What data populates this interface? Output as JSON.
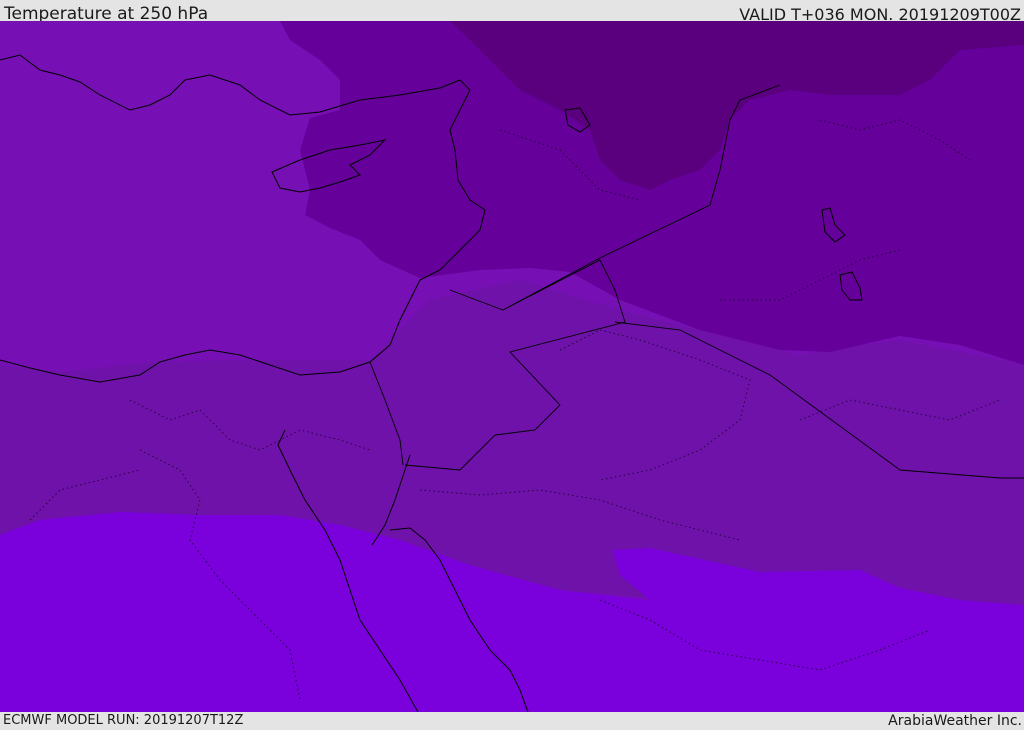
{
  "header": {
    "title": "Temperature at 250 hPa",
    "valid_time": "VALID T+036 MON. 20191209T00Z"
  },
  "footer": {
    "model_run": "ECMWF MODEL RUN: 20191207T12Z",
    "credit": "ArabiaWeather Inc."
  },
  "colors": {
    "band_coldest": "#5a007f",
    "band_cold": "#66009a",
    "band_mid": "#7610b4",
    "band_warm": "#6f12aa",
    "band_warmest": "#7a00dc",
    "coastline": "#000000"
  }
}
